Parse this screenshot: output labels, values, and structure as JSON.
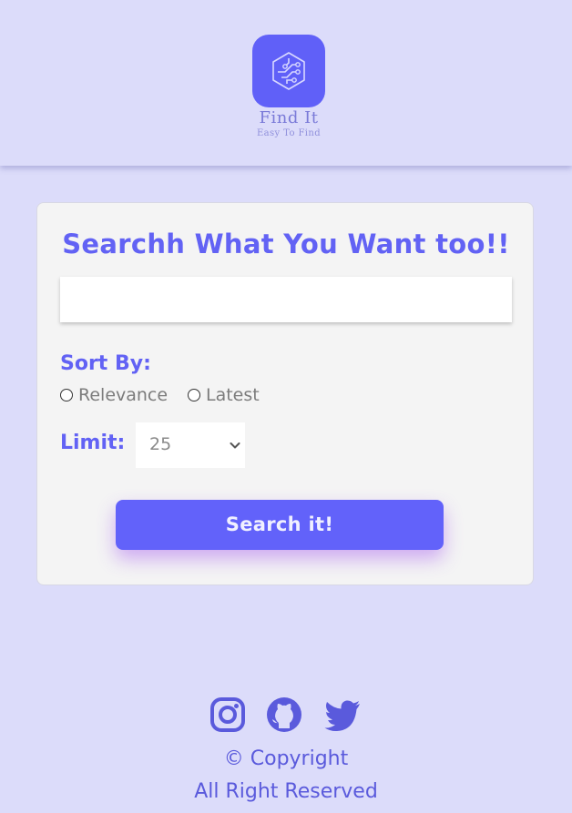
{
  "brand": {
    "title": "Find It",
    "tagline": "Easy To Find",
    "logo_icon": "circuit-hexagon-icon"
  },
  "search": {
    "heading": "Searchh What You Want too!!",
    "input_value": "",
    "input_placeholder": "",
    "button_label": "Search it!"
  },
  "sort": {
    "label": "Sort By:",
    "options": [
      {
        "label": "Relevance",
        "selected": false
      },
      {
        "label": "Latest",
        "selected": false
      }
    ]
  },
  "limit": {
    "label": "Limit:",
    "selected": "25"
  },
  "footer": {
    "socials": [
      "instagram-icon",
      "github-icon",
      "twitter-icon"
    ],
    "copyright": "© Copyright",
    "reserved": "All Right Reserved"
  },
  "colors": {
    "accent": "#6262f4",
    "background": "#dcdcfa",
    "card": "#f4f4f4"
  }
}
